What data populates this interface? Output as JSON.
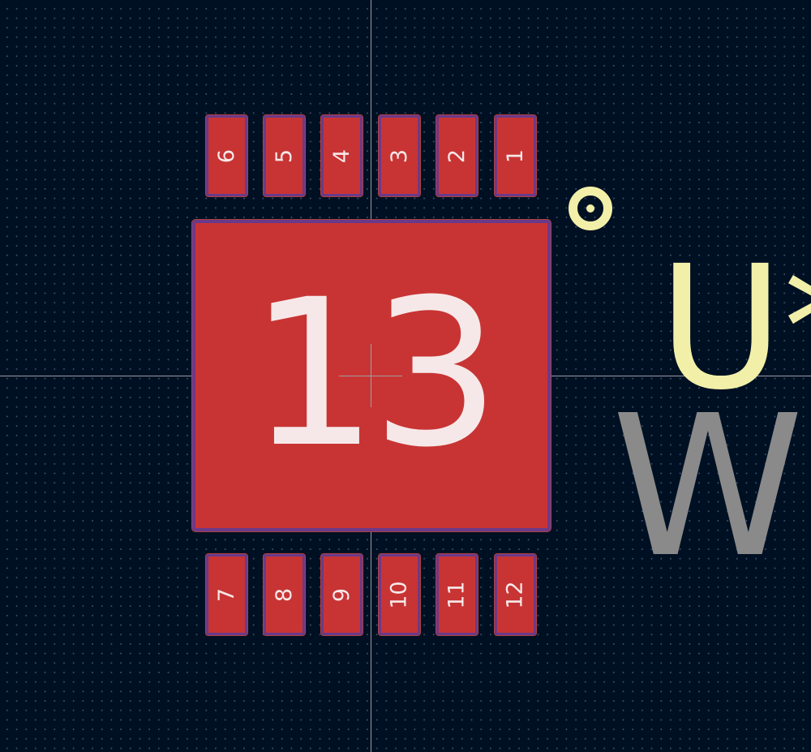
{
  "footprint": {
    "reference": "U*",
    "value": "WS",
    "thermal_pad": "13",
    "pads_top": [
      "6",
      "5",
      "4",
      "3",
      "2",
      "1"
    ],
    "pads_bottom": [
      "7",
      "8",
      "9",
      "10",
      "11",
      "12"
    ]
  },
  "colors": {
    "background": "#001023",
    "pad_fill": "#c83434",
    "pad_border": "#6a3a8a",
    "silkscreen": "#f2f0a8",
    "fab_text": "#8a8a8a"
  }
}
